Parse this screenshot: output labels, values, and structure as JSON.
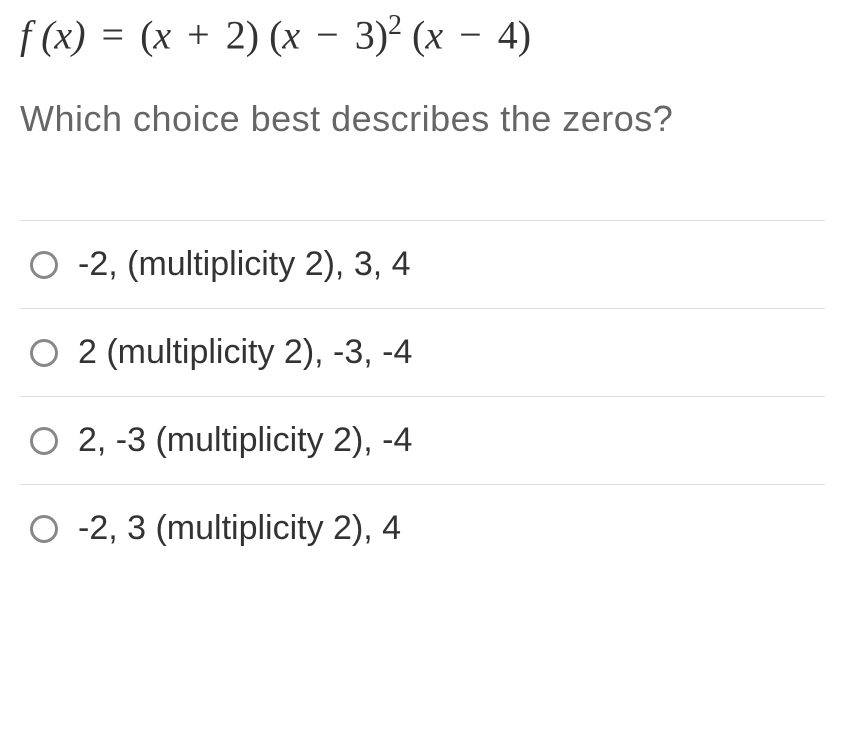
{
  "equation_parts": {
    "lhs": "f (x)",
    "eq": " = ",
    "factor1_open": "(",
    "factor1_var": "x",
    "factor1_op": " + ",
    "factor1_num": "2",
    "factor1_close": ")",
    "factor2_open": " (",
    "factor2_var": "x",
    "factor2_op": " − ",
    "factor2_num": "3",
    "factor2_close": ")",
    "factor2_exp": "2",
    "factor3_open": " (",
    "factor3_var": "x",
    "factor3_op": " − ",
    "factor3_num": "4",
    "factor3_close": ")"
  },
  "question": "Which choice best describes the zeros?",
  "options": [
    "-2, (multiplicity 2), 3, 4",
    "2 (multiplicity 2), -3, -4",
    "2, -3 (multiplicity 2), -4",
    "-2, 3 (multiplicity 2), 4"
  ]
}
